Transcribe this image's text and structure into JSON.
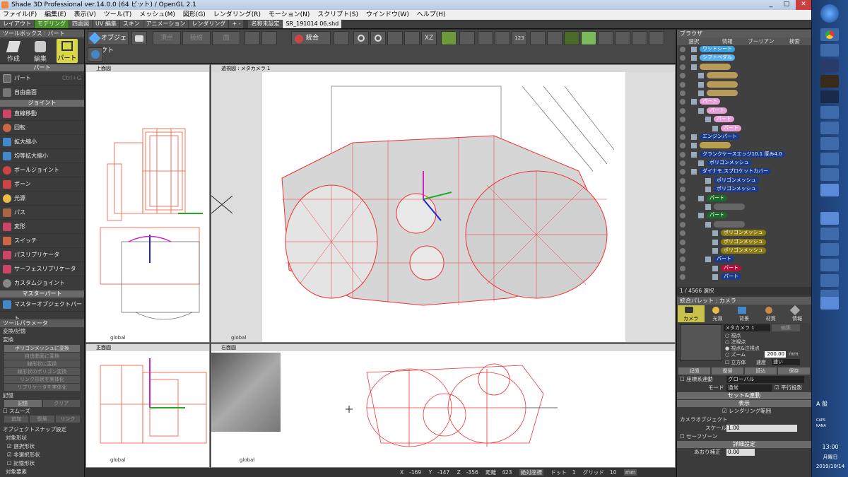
{
  "window": {
    "title": "Shade 3D Professional ver.14.0.0 (64 ビット) / OpenGL 2.1"
  },
  "menu": [
    "ファイル(F)",
    "編集(E)",
    "表示(V)",
    "ツール(T)",
    "メッシュ(M)",
    "図形(G)",
    "レンダリング(R)",
    "モーション(N)",
    "スクリプト(S)",
    "ウインドウ(W)",
    "ヘルプ(H)"
  ],
  "tabs": [
    "レイアウト",
    "モデリング",
    "四面図",
    "UV 編集",
    "スキン",
    "アニメーション",
    "レンダリング",
    "+ -",
    "名称未設定",
    "SR_191014 06.shd"
  ],
  "toolbar": {
    "object_label": "オブジェクト",
    "vertex": "頂点",
    "edge": "稜線",
    "face": "面",
    "integrate": "統合",
    "btn_123": "123"
  },
  "toolbox": {
    "title": "ツールボックス : パート",
    "modes": [
      "作成",
      "編集",
      "パート"
    ],
    "sections": [
      {
        "name": "パート",
        "items": [
          {
            "label": "パート",
            "shortcut": "Ctrl+G"
          },
          {
            "label": "自由曲面",
            "shortcut": ""
          }
        ]
      },
      {
        "name": "ジョイント",
        "items": [
          {
            "label": "直線移動"
          },
          {
            "label": "回転"
          },
          {
            "label": "拡大縮小"
          },
          {
            "label": "均等拡大縮小"
          },
          {
            "label": "ボールジョイント"
          },
          {
            "label": "ボーン"
          },
          {
            "label": "光源"
          },
          {
            "label": "パス"
          },
          {
            "label": "変形"
          },
          {
            "label": "スイッチ"
          },
          {
            "label": "パスリプリケータ"
          },
          {
            "label": "サーフェスリプリケータ"
          },
          {
            "label": "カスタムジョイント"
          }
        ]
      },
      {
        "name": "マスターパート",
        "items": [
          {
            "label": "マスターオブジェクトパート"
          }
        ]
      }
    ]
  },
  "toolparams": {
    "title": "ツールパラメータ",
    "heading": "変換/記憶",
    "sub": "変換",
    "buttons": [
      "ポリゴンメッシュに変換",
      "自由曲面に変換",
      "線形状に変換",
      "線形状のポリゴン変換",
      "リンク形状を実体化",
      "リプリケータを実体化"
    ],
    "memory_label": "記憶",
    "memory_buttons": [
      "記憶",
      "クリア"
    ],
    "smooth_label": "スムーズ",
    "smooth_buttons": [
      "追加",
      "復帰",
      "リンク"
    ],
    "snap_title": "オブジェクトスナップ設定",
    "target_label": "対象形状",
    "checks": [
      "選択形状",
      "非選択形状",
      "記憶形状"
    ],
    "target_elem": "対象要素"
  },
  "viewports": {
    "top_left_label": "上面図",
    "persp_label": "透視図 : メタカメラ 1",
    "front_label": "正面図",
    "right_label": "右面図",
    "axis_label": "global",
    "x": "X",
    "y": "Y",
    "z": "Z"
  },
  "browser": {
    "title": "ブラウザ",
    "tabs": [
      "選択",
      "情報",
      "ブーリアン",
      "検索"
    ],
    "rows": [
      {
        "label": "ウッドシート",
        "color": "#3aa0e0"
      },
      {
        "label": "シフトペダル",
        "color": "#5ab0f0"
      },
      {
        "label": "",
        "color": "#b89a5a"
      },
      {
        "label": "",
        "color": "#b89a5a"
      },
      {
        "label": "",
        "color": "#b89a5a"
      },
      {
        "label": "",
        "color": "#b89a5a"
      },
      {
        "label": "パート",
        "color": "#e8a0d8"
      },
      {
        "label": "パート",
        "color": "#e8a0d8"
      },
      {
        "label": "パート",
        "color": "#e8a0d8"
      },
      {
        "label": "パート",
        "color": "#e8a0d8"
      },
      {
        "label": "エンジンパート",
        "color": "#1a3a8a"
      },
      {
        "label": "",
        "color": "#b8a050"
      },
      {
        "label": "クランクケースエッジ10.1 厚み4.0",
        "color": "#1a3a8a"
      },
      {
        "label": "ポリゴンメッシュ",
        "color": "#1a3a8a"
      },
      {
        "label": "ダイナモ.スプロケットカバー",
        "color": "#1a3a8a"
      },
      {
        "label": "ポリゴンメッシュ",
        "color": "#1a3a8a"
      },
      {
        "label": "ポリゴンメッシュ",
        "color": "#1a3a8a"
      },
      {
        "label": "パート",
        "color": "#1a6a2a"
      },
      {
        "label": "",
        "color": "#666"
      },
      {
        "label": "パート",
        "color": "#1a6a2a"
      },
      {
        "label": "",
        "color": "#666"
      },
      {
        "label": "ポリゴンメッシュ",
        "color": "#8a7a10"
      },
      {
        "label": "ポリゴンメッシュ",
        "color": "#8a7a10"
      },
      {
        "label": "ポリゴンメッシュ",
        "color": "#8a7a10"
      },
      {
        "label": "パート",
        "color": "#1a3a8a"
      },
      {
        "label": "パート",
        "color": "#b01040"
      },
      {
        "label": "パート",
        "color": "#1a3a8a"
      }
    ],
    "status": "1 / 4566 選択"
  },
  "palette": {
    "title": "統合パレット : カメラ",
    "tabs": [
      "カメラ",
      "光源",
      "背景",
      "材質",
      "情報"
    ],
    "camera_name": "メタカメラ 1",
    "edit_btn": "編集",
    "radios": [
      "視点",
      "注視点",
      "視点&注視点",
      "ズーム"
    ],
    "zoom_value": "200.00",
    "zoom_unit": "mm",
    "cube_label": "立方体",
    "speed_label": "速度",
    "speed_value": "速い",
    "row_buttons": [
      "記憶",
      "復帰",
      "読込",
      "保存"
    ],
    "coord_label": "座標系連動",
    "coord_value": "グローバル",
    "mode_label": "モード",
    "mode_value": "通常",
    "parallel_label": "平行投影",
    "set_label": "セット&連動",
    "display_label": "表示",
    "render_range": "レンダリング範囲",
    "camera_object": "カメラオブジェクト",
    "scale_label": "スケール",
    "scale_value": "1.00",
    "safe_zone": "セーフゾーン",
    "detail_label": "詳細設定",
    "tilt_label": "あおり補正",
    "tilt_value": "0.00"
  },
  "status": {
    "x_label": "X",
    "x": "-169",
    "y_label": "Y",
    "y": "-147",
    "z_label": "Z",
    "z": "-356",
    "dist_label": "距離",
    "dist": "423",
    "abs": "絶対座標",
    "dot": "ドット",
    "dot_val": "1",
    "grid": "グリッド",
    "grid_val": "10",
    "unit": "mm"
  },
  "taskbar": {
    "time": "13:00",
    "day": "月曜日",
    "date": "2019/10/14",
    "ime": "A 般",
    "caps": "CAPS",
    "kana": "KANA"
  }
}
